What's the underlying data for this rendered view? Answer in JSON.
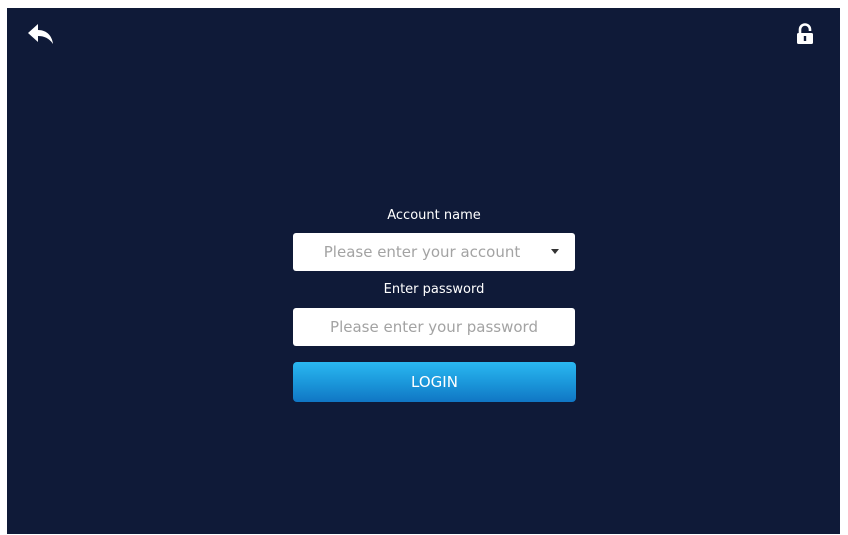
{
  "colors": {
    "background": "#0f1a38",
    "field_background": "#ffffff",
    "login_button_top": "#2ab8f1",
    "login_button_bottom": "#1076c4",
    "text": "#ffffff",
    "placeholder": "#a3a3a3"
  },
  "header": {
    "back_icon": "back-arrow-icon",
    "lock_icon": "lock-icon"
  },
  "login_form": {
    "account_label": "Account name",
    "account_placeholder": "Please enter your account",
    "account_value": "",
    "account_dropdown_icon": "chevron-down-icon",
    "password_label": "Enter password",
    "password_placeholder": "Please enter your password",
    "password_value": "",
    "login_label": "LOGIN"
  }
}
